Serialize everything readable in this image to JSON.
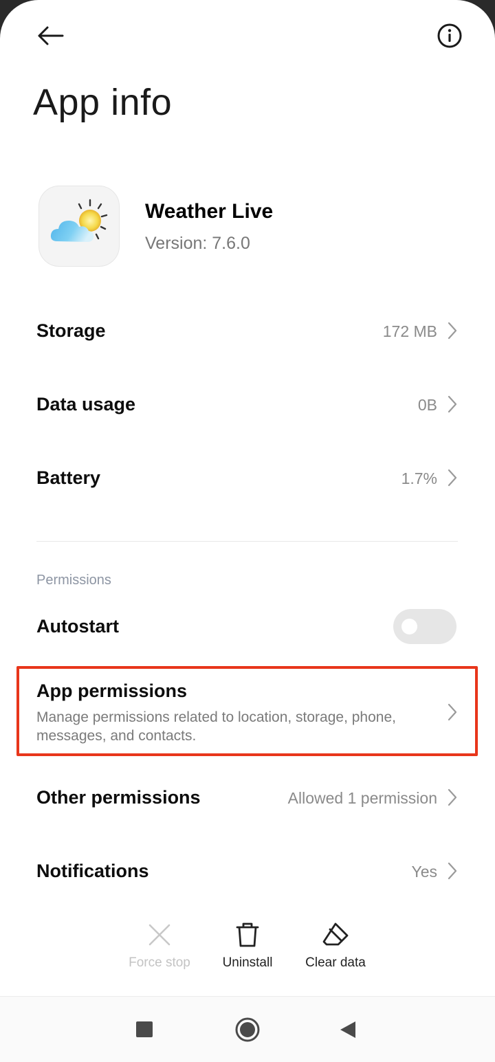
{
  "header": {
    "title": "App info",
    "back_icon": "arrow-left-icon",
    "info_icon": "info-circle-icon"
  },
  "app": {
    "name": "Weather Live",
    "version": "Version: 7.6.0",
    "icon": "weather-cloud-sun-icon"
  },
  "usage": {
    "storage": {
      "label": "Storage",
      "value": "172 MB"
    },
    "data_usage": {
      "label": "Data usage",
      "value": "0B"
    },
    "battery": {
      "label": "Battery",
      "value": "1.7%"
    }
  },
  "permissions": {
    "section_title": "Permissions",
    "autostart": {
      "label": "Autostart",
      "enabled": false
    },
    "app_permissions": {
      "label": "App permissions",
      "description": "Manage permissions related to location, storage, phone, messages, and contacts."
    },
    "other_permissions": {
      "label": "Other permissions",
      "value": "Allowed 1 permission"
    },
    "notifications": {
      "label": "Notifications",
      "value": "Yes"
    }
  },
  "actions": {
    "force_stop": "Force stop",
    "uninstall": "Uninstall",
    "clear_data": "Clear data"
  },
  "colors": {
    "highlight": "#e8361b",
    "toggle_off": "#e6e6e6",
    "secondary_text": "#8a8a8a"
  }
}
